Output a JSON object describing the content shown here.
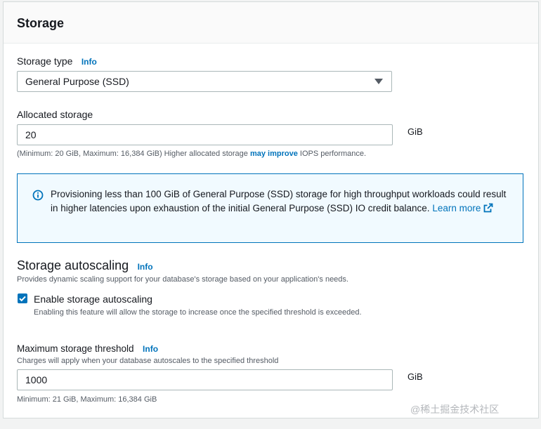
{
  "storage": {
    "title": "Storage",
    "storage_type_label": "Storage type",
    "info": "Info",
    "storage_type_value": "General Purpose (SSD)",
    "allocated_label": "Allocated storage",
    "allocated_value": "20",
    "unit": "GiB",
    "allocated_hint_prefix": "(Minimum: 20 GiB, Maximum: 16,384 GiB) Higher allocated storage ",
    "allocated_hint_link": "may improve",
    "allocated_hint_suffix": " IOPS performance."
  },
  "alert": {
    "text": "Provisioning less than 100 GiB of General Purpose (SSD) storage for high throughput workloads could result in higher latencies upon exhaustion of the initial General Purpose (SSD) IO credit balance. ",
    "link": "Learn more"
  },
  "autoscaling": {
    "title": "Storage autoscaling",
    "info": "Info",
    "description": "Provides dynamic scaling support for your database's storage based on your application's needs.",
    "checkbox_label": "Enable storage autoscaling",
    "checkbox_checked": true,
    "checkbox_description": "Enabling this feature will allow the storage to increase once the specified threshold is exceeded.",
    "threshold_label": "Maximum storage threshold",
    "threshold_info": "Info",
    "threshold_hint": "Charges will apply when your database autoscales to the specified threshold",
    "threshold_value": "1000",
    "unit": "GiB",
    "threshold_range": "Minimum: 21 GiB, Maximum: 16,384 GiB"
  },
  "watermark": "@稀土掘金技术社区",
  "colors": {
    "link": "#0073bb",
    "alert_bg": "#f1faff",
    "alert_border": "#0073bb",
    "checkbox": "#0073bb"
  }
}
